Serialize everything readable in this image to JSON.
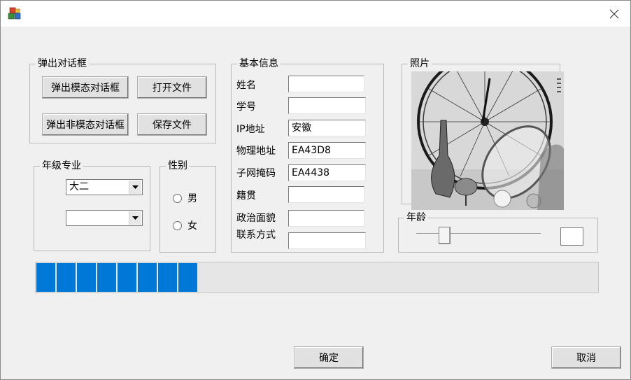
{
  "window": {
    "close_icon": "close-icon",
    "app_icon": "app-icon"
  },
  "dialog_group": {
    "title": "弹出对话框",
    "modal_label": "弹出模态对话框",
    "open_file_label": "打开文件",
    "modeless_label": "弹出非模态对话框",
    "save_file_label": "保存文件"
  },
  "grade_group": {
    "title": "年级专业",
    "grade_value": "大二",
    "major_value": ""
  },
  "gender_group": {
    "title": "性别",
    "options": [
      "男",
      "女"
    ]
  },
  "info_group": {
    "title": "基本信息",
    "fields": [
      {
        "label": "姓名",
        "value": ""
      },
      {
        "label": "学号",
        "value": ""
      },
      {
        "label": "IP地址",
        "value": "安徽"
      },
      {
        "label": "物理地址",
        "value": "EA43D8"
      },
      {
        "label": "子网掩码",
        "value": "EA4438"
      },
      {
        "label": "籍贯",
        "value": ""
      },
      {
        "label": "政治面貌",
        "value": ""
      },
      {
        "label": "联系方式",
        "value": ""
      }
    ]
  },
  "photo_group": {
    "title": "照片"
  },
  "age_group": {
    "title": "年龄",
    "value": "",
    "slider_fraction": 0.2
  },
  "progress": {
    "fraction": 0.29
  },
  "footer": {
    "ok_label": "确定",
    "cancel_label": "取消"
  }
}
